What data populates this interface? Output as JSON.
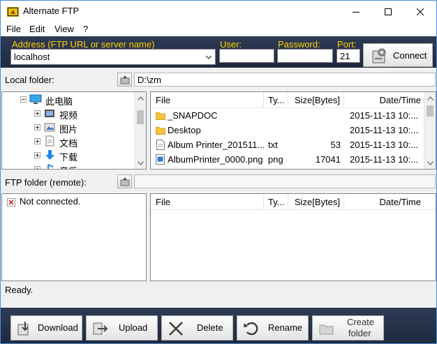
{
  "window": {
    "title": "Alternate FTP"
  },
  "menu": [
    "File",
    "Edit",
    "View",
    "?"
  ],
  "connection": {
    "address_label": "Address (FTP URL or server name)",
    "address_value": "localhost",
    "user_label": "User:",
    "user_value": "",
    "password_label": "Password:",
    "password_value": "",
    "port_label": "Port:",
    "port_value": "21",
    "connect_label": "Connect"
  },
  "local": {
    "label": "Local folder:",
    "path": "D:\\zm",
    "tree": [
      {
        "label": "此电脑",
        "icon": "computer-icon",
        "expander": "minus"
      },
      {
        "label": "视频",
        "icon": "video-folder-icon",
        "expander": "plus"
      },
      {
        "label": "图片",
        "icon": "pictures-folder-icon",
        "expander": "plus"
      },
      {
        "label": "文档",
        "icon": "documents-folder-icon",
        "expander": "plus"
      },
      {
        "label": "下载",
        "icon": "download-folder-icon",
        "expander": "plus"
      },
      {
        "label": "音乐",
        "icon": "music-folder-icon",
        "expander": "plus"
      }
    ],
    "columns": [
      "File",
      "Ty...",
      "Size[Bytes]",
      "Date/Time"
    ],
    "files": [
      {
        "name": "_SNAPDOC",
        "type": "",
        "size": "",
        "date": "2015-11-13 10:...",
        "icon": "folder-icon"
      },
      {
        "name": "Desktop",
        "type": "",
        "size": "",
        "date": "2015-11-13 10:...",
        "icon": "folder-icon"
      },
      {
        "name": "Album Printer_201511...",
        "type": "txt",
        "size": "53",
        "date": "2015-11-13 10:...",
        "icon": "text-file-icon"
      },
      {
        "name": "AlbumPrinter_0000.png",
        "type": "png",
        "size": "17041",
        "date": "2015-11-13 10:...",
        "icon": "image-file-icon"
      }
    ]
  },
  "remote": {
    "label": "FTP folder (remote):",
    "path": "",
    "tree_message": "Not connected.",
    "columns": [
      "File",
      "Ty...",
      "Size[Bytes]",
      "Date/Time"
    ]
  },
  "status": "Ready.",
  "toolbar": {
    "download": "Download",
    "upload": "Upload",
    "delete": "Delete",
    "rename": "Rename",
    "create_folder_line1": "Create",
    "create_folder_line2": "folder"
  },
  "colors": {
    "accent_label": "#ffd200",
    "bar_bg": "#253049",
    "folder": "#f5c542"
  }
}
